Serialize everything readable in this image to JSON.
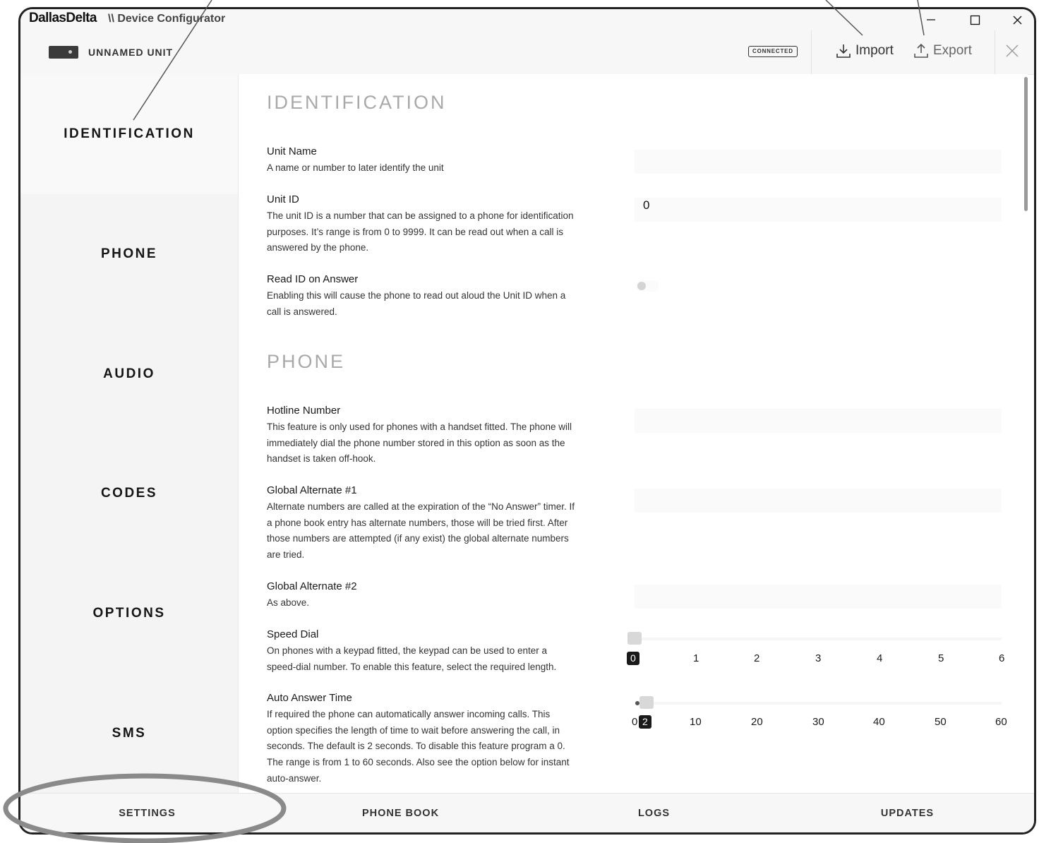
{
  "titlebar": {
    "brand": "DallasDelta",
    "title": "\\\\ Device Configurator",
    "minimize_icon": "minimize-icon",
    "maximize_icon": "maximize-icon",
    "close_icon": "close-icon"
  },
  "header": {
    "unit_name": "UNNAMED UNIT",
    "status": "CONNECTED",
    "import_label": "Import",
    "export_label": "Export"
  },
  "sidebar": {
    "items": [
      {
        "label": "IDENTIFICATION"
      },
      {
        "label": "PHONE"
      },
      {
        "label": "AUDIO"
      },
      {
        "label": "CODES"
      },
      {
        "label": "OPTIONS"
      },
      {
        "label": "SMS"
      }
    ]
  },
  "sections": {
    "identification": {
      "title": "IDENTIFICATION",
      "unit_name": {
        "title": "Unit Name",
        "desc": "A name or number to later identify the unit",
        "value": ""
      },
      "unit_id": {
        "title": "Unit ID",
        "desc": "The unit ID is a number that can be assigned to a phone for identification purposes. It’s range is from 0 to 9999. It can be read out when a call is answered by the phone.",
        "value": "0"
      },
      "read_id": {
        "title": "Read ID on Answer",
        "desc": "Enabling this will cause the phone to read out aloud the Unit ID when a call is answered.",
        "enabled": false
      }
    },
    "phone": {
      "title": "PHONE",
      "hotline": {
        "title": "Hotline Number",
        "desc": "This feature is only used for phones with a handset fitted. The phone will immediately dial the phone number stored in this option as soon as the handset is taken off-hook.",
        "value": ""
      },
      "alt1": {
        "title": "Global Alternate #1",
        "desc": "Alternate numbers are called at the expiration of the “No Answer” timer. If a phone book entry has alternate numbers, those will be tried first. After those numbers are attempted (if any exist) the global alternate numbers are tried.",
        "value": ""
      },
      "alt2": {
        "title": "Global Alternate #2",
        "desc": "As above.",
        "value": ""
      },
      "speed_dial": {
        "title": "Speed Dial",
        "desc": "On phones with a keypad fitted, the keypad can be used to enter a speed-dial number. To enable this feature, select the required length.",
        "ticks": [
          "0",
          "1",
          "2",
          "3",
          "4",
          "5",
          "6"
        ],
        "selected": "0"
      },
      "auto_answer": {
        "title": "Auto Answer Time",
        "desc": "If required the phone can automatically answer incoming calls. This option specifies the length of time to wait before answering the call, in seconds. The default is 2 seconds. To disable this feature program a 0. The range is from 1 to 60 seconds. Also see the option below for instant auto-answer.",
        "ticks": [
          "0",
          "10",
          "20",
          "30",
          "40",
          "50",
          "60"
        ],
        "selected": "2"
      }
    }
  },
  "tabs": [
    {
      "label": "SETTINGS"
    },
    {
      "label": "PHONE BOOK"
    },
    {
      "label": "LOGS"
    },
    {
      "label": "UPDATES"
    }
  ]
}
